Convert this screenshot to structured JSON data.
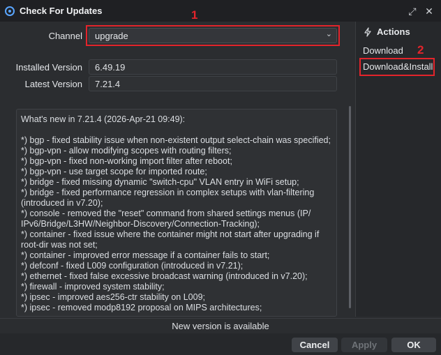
{
  "window": {
    "title": "Check For Updates"
  },
  "form": {
    "channel_label": "Channel",
    "channel_value": "upgrade",
    "installed_label": "Installed Version",
    "installed_value": "6.49.19",
    "latest_label": "Latest Version",
    "latest_value": "7.21.4"
  },
  "notes": {
    "lines": [
      "What's new in 7.21.4 (2026-Apr-21 09:49):",
      "",
      "*) bgp - fixed stability issue when non-existent output select-chain was specified;",
      "*) bgp-vpn - allow modifying scopes with routing filters;",
      "*) bgp-vpn - fixed non-working import filter after reboot;",
      "*) bgp-vpn - use target scope for imported route;",
      "*) bridge - fixed missing dynamic \"switch-cpu\" VLAN entry in WiFi setup;",
      "*) bridge - fixed performance regression in complex setups with vlan-filtering (introduced in v7.20);",
      "*) console - removed the \"reset\" command from shared settings menus (IP/ IPv6/Bridge/L3HW/Neighbor-Discovery/Connection-Tracking);",
      "*) container - fixed issue where the container might not start after upgrading if root-dir was not set;",
      "*) container - improved error message if a container fails to start;",
      "*) defconf - fixed L009 configuration (introduced in v7.21);",
      "*) ethernet - fixed false excessive broadcast warning (introduced in v7.20);",
      "*) firewall - improved system stability;",
      "*) ipsec - improved aes256-ctr stability on L009;",
      "*) ipsec - removed modp8192 proposal on MIPS architectures;"
    ]
  },
  "sidebar": {
    "title": "Actions",
    "items": [
      "Download",
      "Download&Install"
    ]
  },
  "status_text": "New version is available",
  "buttons": {
    "cancel": "Cancel",
    "apply": "Apply",
    "ok": "OK"
  },
  "annotations": {
    "one": "1",
    "two": "2"
  }
}
